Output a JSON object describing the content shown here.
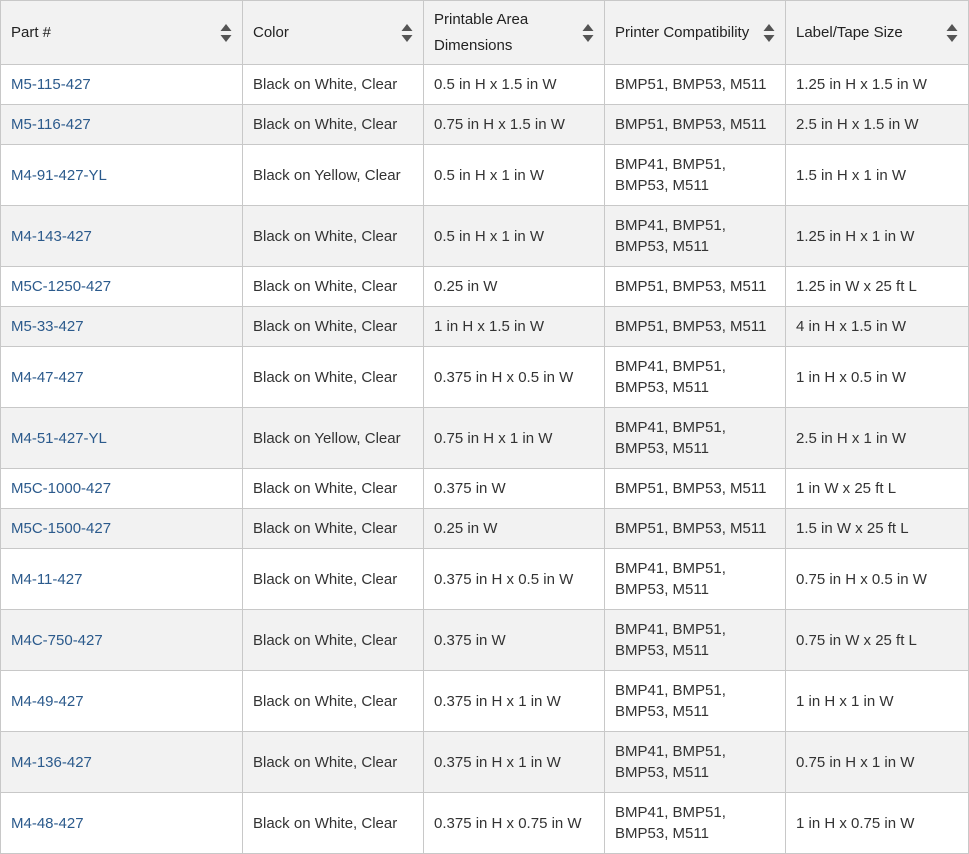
{
  "table": {
    "headers": [
      {
        "label": "Part #"
      },
      {
        "label": "Color"
      },
      {
        "label": "Printable Area Dimensions"
      },
      {
        "label": "Printer Compatibility"
      },
      {
        "label": "Label/Tape Size"
      }
    ],
    "rows": [
      {
        "part": "M5-115-427",
        "color": "Black on White, Clear",
        "dims": "0.5 in H x 1.5 in W",
        "compat": "BMP51, BMP53, M511",
        "size": "1.25 in H x 1.5 in W"
      },
      {
        "part": "M5-116-427",
        "color": "Black on White, Clear",
        "dims": "0.75 in H x 1.5 in W",
        "compat": "BMP51, BMP53, M511",
        "size": "2.5 in H x 1.5 in W"
      },
      {
        "part": "M4-91-427-YL",
        "color": "Black on Yellow, Clear",
        "dims": "0.5 in H x 1 in W",
        "compat": "BMP41, BMP51, BMP53, M511",
        "size": "1.5 in H x 1 in W"
      },
      {
        "part": "M4-143-427",
        "color": "Black on White, Clear",
        "dims": "0.5 in H x 1 in W",
        "compat": "BMP41, BMP51, BMP53, M511",
        "size": "1.25 in H x 1 in W"
      },
      {
        "part": "M5C-1250-427",
        "color": "Black on White, Clear",
        "dims": "0.25 in W",
        "compat": "BMP51, BMP53, M511",
        "size": "1.25 in W x 25 ft L"
      },
      {
        "part": "M5-33-427",
        "color": "Black on White, Clear",
        "dims": "1 in H x 1.5 in W",
        "compat": "BMP51, BMP53, M511",
        "size": "4 in H x 1.5 in W"
      },
      {
        "part": "M4-47-427",
        "color": "Black on White, Clear",
        "dims": "0.375 in H x 0.5 in W",
        "compat": "BMP41, BMP51, BMP53, M511",
        "size": "1 in H x 0.5 in W"
      },
      {
        "part": "M4-51-427-YL",
        "color": "Black on Yellow, Clear",
        "dims": "0.75 in H x 1 in W",
        "compat": "BMP41, BMP51, BMP53, M511",
        "size": "2.5 in H x 1 in W"
      },
      {
        "part": "M5C-1000-427",
        "color": "Black on White, Clear",
        "dims": "0.375 in W",
        "compat": "BMP51, BMP53, M511",
        "size": "1 in W x 25 ft L"
      },
      {
        "part": "M5C-1500-427",
        "color": "Black on White, Clear",
        "dims": "0.25 in W",
        "compat": "BMP51, BMP53, M511",
        "size": "1.5 in W x 25 ft L"
      },
      {
        "part": "M4-11-427",
        "color": "Black on White, Clear",
        "dims": "0.375 in H x 0.5 in W",
        "compat": "BMP41, BMP51, BMP53, M511",
        "size": "0.75 in H x 0.5 in W"
      },
      {
        "part": "M4C-750-427",
        "color": "Black on White, Clear",
        "dims": "0.375 in W",
        "compat": "BMP41, BMP51, BMP53, M511",
        "size": "0.75 in W x 25 ft L"
      },
      {
        "part": "M4-49-427",
        "color": "Black on White, Clear",
        "dims": "0.375 in H x 1 in W",
        "compat": "BMP41, BMP51, BMP53, M511",
        "size": "1 in H x 1 in W"
      },
      {
        "part": "M4-136-427",
        "color": "Black on White, Clear",
        "dims": "0.375 in H x 1 in W",
        "compat": "BMP41, BMP51, BMP53, M511",
        "size": "0.75 in H x 1 in W"
      },
      {
        "part": "M4-48-427",
        "color": "Black on White, Clear",
        "dims": "0.375 in H x 0.75 in W",
        "compat": "BMP41, BMP51, BMP53, M511",
        "size": "1 in H x 0.75 in W"
      }
    ]
  },
  "icons": {
    "sort": "sort-arrows-icon"
  },
  "colors": {
    "link": "#2b5a8c",
    "header_bg": "#f2f2f2",
    "stripe_bg": "#f2f2f2",
    "border": "#c8c8c8"
  }
}
